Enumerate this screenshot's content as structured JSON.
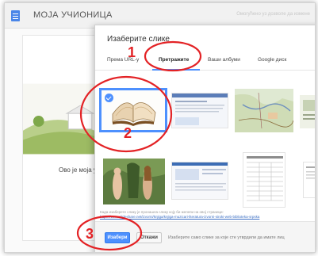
{
  "app": {
    "title": "МОЈА УЧИОНИЦА",
    "top_right": "Омогућено уз дозволе да измене"
  },
  "background": {
    "card_text": "Ово је моја у"
  },
  "dialog": {
    "title": "Изаберите слике",
    "tabs": [
      {
        "label": "Према URL-у",
        "active": false
      },
      {
        "label": "Претражите",
        "active": true
      },
      {
        "label": "Ваши албуми",
        "active": false
      },
      {
        "label": "Google диск",
        "active": false
      }
    ],
    "images": [
      {
        "name": "open-book",
        "selected": true
      },
      {
        "name": "screenshot-page",
        "selected": false
      },
      {
        "name": "map",
        "selected": false
      },
      {
        "name": "partial-image",
        "selected": false
      },
      {
        "name": "adam-eve-painting",
        "selected": false
      },
      {
        "name": "web-page",
        "selected": false
      },
      {
        "name": "table-document",
        "selected": false
      },
      {
        "name": "partial-document",
        "selected": false
      }
    ],
    "hint_text": "Када изаберете слику је пронашла слику коју би желели на овој страници:",
    "hint_link": "https://www.slideshare.net/izvorni/knjiga/knjiga-muzicari-literatura-izvorni-siroki-web-biblioteka-srpska",
    "select_button": "Изабери",
    "cancel_button": "Откажи",
    "footer_note": "Изаберите само слике за које сте утврдили да имате лиц"
  },
  "annotations": [
    "1",
    "2",
    "3"
  ],
  "colors": {
    "accent": "#4d90fe",
    "annotation": "#e32225"
  }
}
